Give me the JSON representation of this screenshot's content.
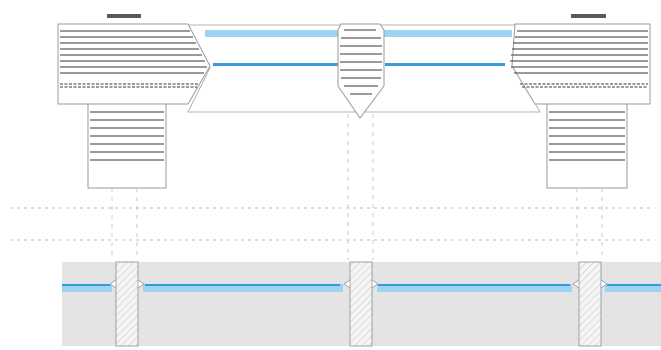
{
  "diagram": {
    "title": "",
    "colors": {
      "background": "#ffffff",
      "outline": "#9a9a9a",
      "hatch": "#5e5e5e",
      "blue": "#3a9ad9",
      "light_blue": "#9fd3f2",
      "red_guide": "#e8a9a9",
      "gray_dash": "#c8c8c8",
      "band_fill": "#e4e4e4",
      "post_fill": "#f4f4f4",
      "cap": "#5a5a5a"
    },
    "labels": []
  }
}
